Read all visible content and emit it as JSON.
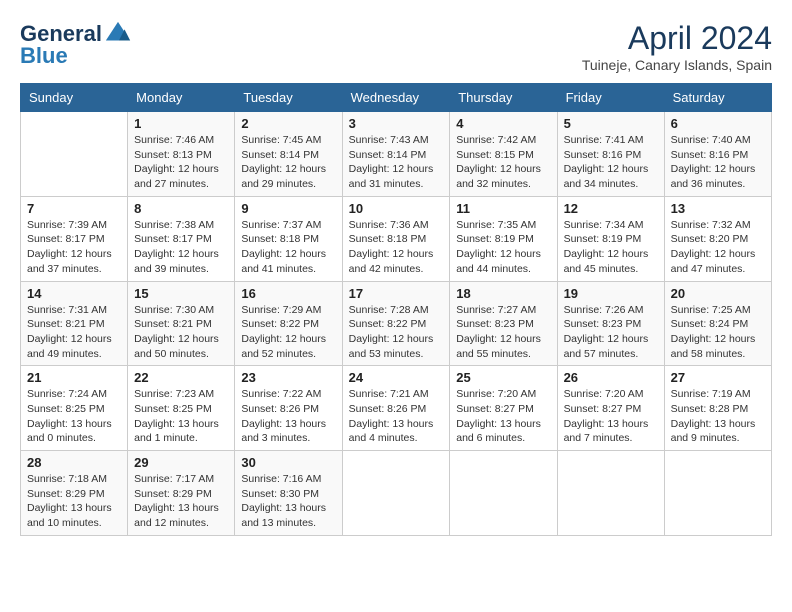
{
  "header": {
    "logo_line1": "General",
    "logo_line2": "Blue",
    "month_title": "April 2024",
    "location": "Tuineje, Canary Islands, Spain"
  },
  "weekdays": [
    "Sunday",
    "Monday",
    "Tuesday",
    "Wednesday",
    "Thursday",
    "Friday",
    "Saturday"
  ],
  "weeks": [
    [
      {
        "day": "",
        "info": ""
      },
      {
        "day": "1",
        "info": "Sunrise: 7:46 AM\nSunset: 8:13 PM\nDaylight: 12 hours\nand 27 minutes."
      },
      {
        "day": "2",
        "info": "Sunrise: 7:45 AM\nSunset: 8:14 PM\nDaylight: 12 hours\nand 29 minutes."
      },
      {
        "day": "3",
        "info": "Sunrise: 7:43 AM\nSunset: 8:14 PM\nDaylight: 12 hours\nand 31 minutes."
      },
      {
        "day": "4",
        "info": "Sunrise: 7:42 AM\nSunset: 8:15 PM\nDaylight: 12 hours\nand 32 minutes."
      },
      {
        "day": "5",
        "info": "Sunrise: 7:41 AM\nSunset: 8:16 PM\nDaylight: 12 hours\nand 34 minutes."
      },
      {
        "day": "6",
        "info": "Sunrise: 7:40 AM\nSunset: 8:16 PM\nDaylight: 12 hours\nand 36 minutes."
      }
    ],
    [
      {
        "day": "7",
        "info": "Sunrise: 7:39 AM\nSunset: 8:17 PM\nDaylight: 12 hours\nand 37 minutes."
      },
      {
        "day": "8",
        "info": "Sunrise: 7:38 AM\nSunset: 8:17 PM\nDaylight: 12 hours\nand 39 minutes."
      },
      {
        "day": "9",
        "info": "Sunrise: 7:37 AM\nSunset: 8:18 PM\nDaylight: 12 hours\nand 41 minutes."
      },
      {
        "day": "10",
        "info": "Sunrise: 7:36 AM\nSunset: 8:18 PM\nDaylight: 12 hours\nand 42 minutes."
      },
      {
        "day": "11",
        "info": "Sunrise: 7:35 AM\nSunset: 8:19 PM\nDaylight: 12 hours\nand 44 minutes."
      },
      {
        "day": "12",
        "info": "Sunrise: 7:34 AM\nSunset: 8:19 PM\nDaylight: 12 hours\nand 45 minutes."
      },
      {
        "day": "13",
        "info": "Sunrise: 7:32 AM\nSunset: 8:20 PM\nDaylight: 12 hours\nand 47 minutes."
      }
    ],
    [
      {
        "day": "14",
        "info": "Sunrise: 7:31 AM\nSunset: 8:21 PM\nDaylight: 12 hours\nand 49 minutes."
      },
      {
        "day": "15",
        "info": "Sunrise: 7:30 AM\nSunset: 8:21 PM\nDaylight: 12 hours\nand 50 minutes."
      },
      {
        "day": "16",
        "info": "Sunrise: 7:29 AM\nSunset: 8:22 PM\nDaylight: 12 hours\nand 52 minutes."
      },
      {
        "day": "17",
        "info": "Sunrise: 7:28 AM\nSunset: 8:22 PM\nDaylight: 12 hours\nand 53 minutes."
      },
      {
        "day": "18",
        "info": "Sunrise: 7:27 AM\nSunset: 8:23 PM\nDaylight: 12 hours\nand 55 minutes."
      },
      {
        "day": "19",
        "info": "Sunrise: 7:26 AM\nSunset: 8:23 PM\nDaylight: 12 hours\nand 57 minutes."
      },
      {
        "day": "20",
        "info": "Sunrise: 7:25 AM\nSunset: 8:24 PM\nDaylight: 12 hours\nand 58 minutes."
      }
    ],
    [
      {
        "day": "21",
        "info": "Sunrise: 7:24 AM\nSunset: 8:25 PM\nDaylight: 13 hours\nand 0 minutes."
      },
      {
        "day": "22",
        "info": "Sunrise: 7:23 AM\nSunset: 8:25 PM\nDaylight: 13 hours\nand 1 minute."
      },
      {
        "day": "23",
        "info": "Sunrise: 7:22 AM\nSunset: 8:26 PM\nDaylight: 13 hours\nand 3 minutes."
      },
      {
        "day": "24",
        "info": "Sunrise: 7:21 AM\nSunset: 8:26 PM\nDaylight: 13 hours\nand 4 minutes."
      },
      {
        "day": "25",
        "info": "Sunrise: 7:20 AM\nSunset: 8:27 PM\nDaylight: 13 hours\nand 6 minutes."
      },
      {
        "day": "26",
        "info": "Sunrise: 7:20 AM\nSunset: 8:27 PM\nDaylight: 13 hours\nand 7 minutes."
      },
      {
        "day": "27",
        "info": "Sunrise: 7:19 AM\nSunset: 8:28 PM\nDaylight: 13 hours\nand 9 minutes."
      }
    ],
    [
      {
        "day": "28",
        "info": "Sunrise: 7:18 AM\nSunset: 8:29 PM\nDaylight: 13 hours\nand 10 minutes."
      },
      {
        "day": "29",
        "info": "Sunrise: 7:17 AM\nSunset: 8:29 PM\nDaylight: 13 hours\nand 12 minutes."
      },
      {
        "day": "30",
        "info": "Sunrise: 7:16 AM\nSunset: 8:30 PM\nDaylight: 13 hours\nand 13 minutes."
      },
      {
        "day": "",
        "info": ""
      },
      {
        "day": "",
        "info": ""
      },
      {
        "day": "",
        "info": ""
      },
      {
        "day": "",
        "info": ""
      }
    ]
  ]
}
